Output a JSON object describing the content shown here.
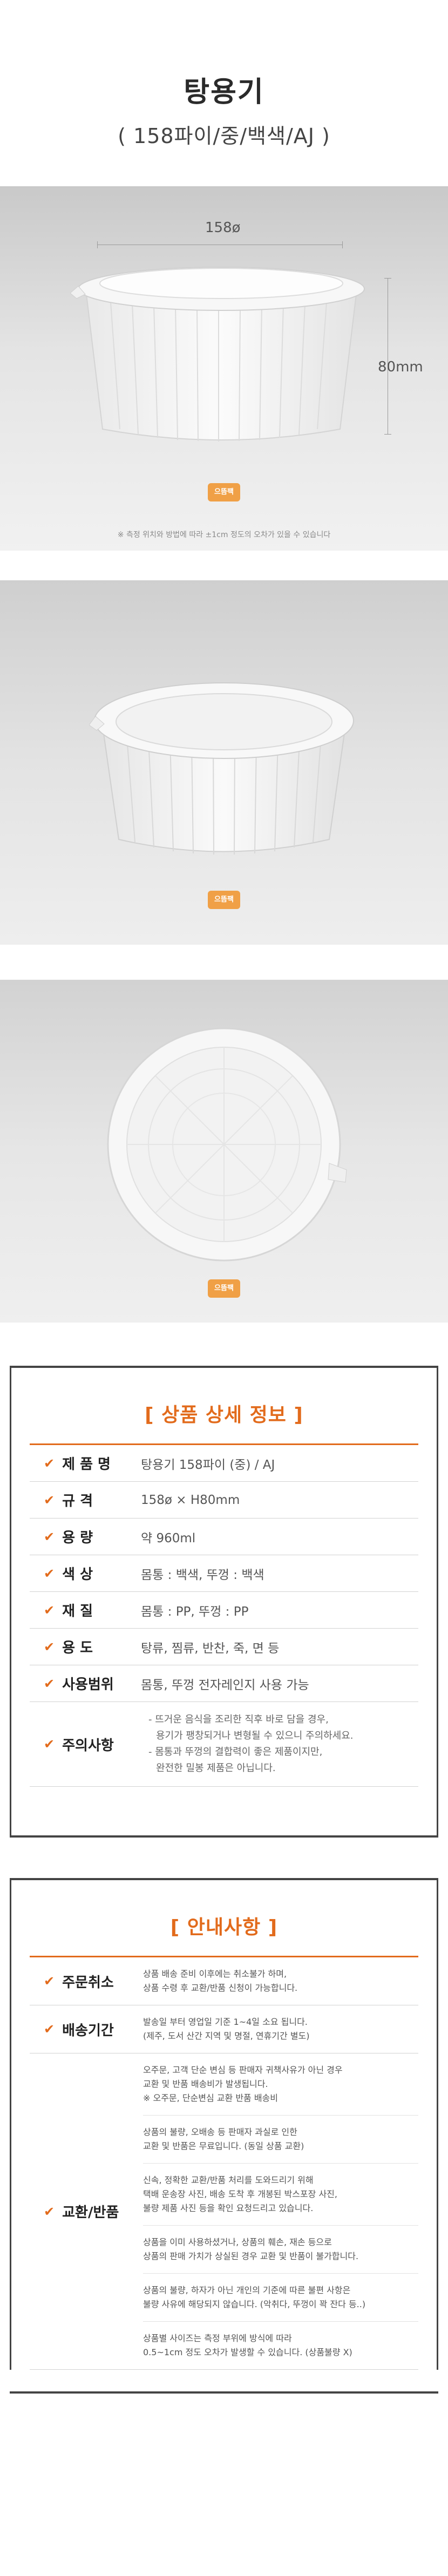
{
  "header": {
    "title": "탕용기",
    "subtitle": "( 158파이/중/백색/AJ )"
  },
  "photo1": {
    "width_label": "158ø",
    "height_label": "80mm",
    "caption": "※ 측정 위치와 방법에 따라 ±1cm 정도의 오차가 있을 수 있습니다"
  },
  "brand_logo": "으뜸팩",
  "spec_section": {
    "title": "[ 상품 상세 정보 ]",
    "rows": [
      {
        "label": "제 품 명",
        "value": "탕용기 158파이 (중) / AJ"
      },
      {
        "label": "규  격",
        "value": "158ø × H80mm"
      },
      {
        "label": "용  량",
        "value": "약 960ml"
      },
      {
        "label": "색  상",
        "value": "몸통 : 백색,  뚜껑 : 백색"
      },
      {
        "label": "재  질",
        "value": "몸통 : PP,  뚜껑 : PP"
      },
      {
        "label": "용  도",
        "value": "탕류, 찜류, 반찬, 죽, 면 등"
      },
      {
        "label": "사용범위",
        "value": "몸통, 뚜껑 전자레인지 사용 가능"
      }
    ],
    "caution_label": "주의사항",
    "caution_lines": [
      "- 뜨거운 음식을 조리한 직후 바로 담을 경우,",
      "  용기가 팽창되거나 변형될 수 있으니 주의하세요.",
      "- 몸통과 뚜껑의 결합력이 좋은 제품이지만,",
      "  완전한 밀봉 제품은 아닙니다."
    ]
  },
  "notice_section": {
    "title": "[ 안내사항 ]",
    "rows": [
      {
        "label": "주문취소",
        "blocks": [
          [
            "상품 배송 준비 이후에는 취소불가 하며,",
            "상품 수령 후 교환/반품 신청이 가능합니다."
          ]
        ]
      },
      {
        "label": "배송기간",
        "blocks": [
          [
            "발송일 부터 영업일 기준 1~4일 소요 됩니다.",
            "(제주, 도서 산간 지역 및 명절, 연휴기간 별도)"
          ]
        ]
      },
      {
        "label": "교환/반품",
        "blocks": [
          [
            "오주문, 고객 단순 변심 등 판매자 귀책사유가 아닌 경우",
            "교환 및 반품 배송비가 발생됩니다.",
            "※ 오주문, 단순변심 교환 반품 배송비"
          ],
          [
            "상품의 불량, 오배송 등 판매자 과실로 인한",
            "교환 및 반품은 무료입니다. (동일 상품 교환)"
          ],
          [
            "신속, 정확한 교환/반품 처리를 도와드리기 위해",
            "택배 운송장 사진, 배송 도착 후 개봉된 박스포장 사진,",
            "불량 제품 사진 등을 확인 요청드리고 있습니다."
          ],
          [
            "상품을 이미 사용하셨거나, 상품의 훼손, 재손 등으로",
            "상품의 판매 가치가 상실된 경우 교환 및 반품이 불가합니다."
          ],
          [
            "상품의 불량, 하자가 아닌 개인의 기준에 따른 불편 사항은",
            "불량 사유에 해당되지 않습니다. (악취다, 뚜껑이 꽉 잔다 등..)"
          ],
          [
            "상품별 사이즈는 측정 부위에 방식에 따라",
            "0.5~1cm 정도 오차가 발생할 수 있습니다. (상품불량 X)"
          ]
        ]
      }
    ]
  }
}
